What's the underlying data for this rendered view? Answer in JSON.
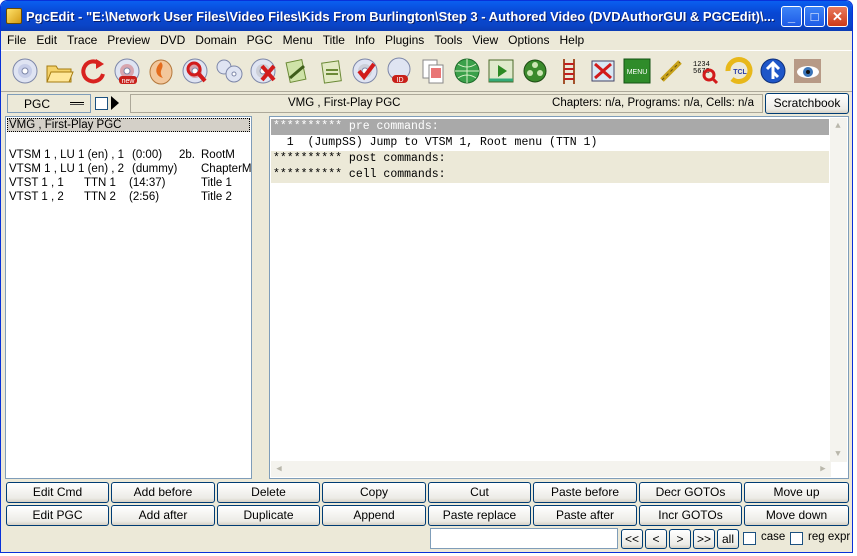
{
  "window": {
    "title": "PgcEdit -   \"E:\\Network User Files\\Video Files\\Kids From Burlington\\Step 3 - Authored Video (DVDAuthorGUI & PGCEdit)\\...",
    "minimize": "_",
    "maximize": "□",
    "close": "✕"
  },
  "menu": [
    "File",
    "Edit",
    "Trace",
    "Preview",
    "DVD",
    "Domain",
    "PGC",
    "Menu",
    "Title",
    "Info",
    "Plugins",
    "Tools",
    "View",
    "Options",
    "Help"
  ],
  "toolbar_icons": [
    "open-dvd-icon",
    "open-folder-icon",
    "reload-icon",
    "new-dvd-icon",
    "burn-icon",
    "search-dvd-icon",
    "dvd-structure-icon",
    "dvd-delete-icon",
    "copy-commands-icon",
    "paste-commands-icon",
    "check-icon",
    "dvd-id-icon",
    "documents-icon",
    "web-icon",
    "play-preview-icon",
    "film-reel-icon",
    "ladder-icon",
    "cell-editor-icon",
    "menu-icon",
    "chain-link-icon",
    "gprm-search-icon",
    "tcl-icon",
    "navigate-icon",
    "eye-icon"
  ],
  "toolbar_labels": {
    "menu_icon_text": "MENU",
    "tcl_text": "TCL",
    "id_text": "ID",
    "new_text": "new"
  },
  "pgc_selector": {
    "value": "PGC"
  },
  "status": {
    "pgc_name": "VMG , First-Play PGC",
    "counts": "Chapters: n/a, Programs: n/a, Cells: n/a",
    "scratchbook": "Scratchbook"
  },
  "pgc_list": {
    "header": "VMG , First-Play PGC",
    "rows": [
      {
        "domain": "VTSM 1 , LU 1 (en) , 1",
        "time": "(0:00)",
        "extra": "2b.",
        "menu": "RootM"
      },
      {
        "domain": "VTSM 1 , LU 1 (en) , 2",
        "time": "(dummy)",
        "extra": "",
        "menu": "ChapterM"
      },
      {
        "domain": "VTST 1 , 1",
        "time": "TTN 1",
        "extra": "(14:37)",
        "menu": "Title 1"
      },
      {
        "domain": "VTST 1 , 2",
        "time": "TTN 2",
        "extra": "(2:56)",
        "menu": "Title 2"
      }
    ]
  },
  "commands": [
    "********** pre commands:",
    "  1  (JumpSS) Jump to VTSM 1, Root menu (TTN 1)",
    "********** post commands:",
    "********** cell commands:"
  ],
  "buttons": {
    "row1": [
      "Edit Cmd",
      "Add before",
      "Delete",
      "Copy",
      "Cut",
      "Paste before",
      "Decr GOTOs",
      "Move up"
    ],
    "row2": [
      "Edit PGC",
      "Add after",
      "Duplicate",
      "Append",
      "Paste replace",
      "Paste after",
      "Incr GOTOs",
      "Move down"
    ]
  },
  "find": {
    "value": "",
    "nav": [
      "<<",
      "<",
      ">",
      ">>"
    ],
    "all": "all",
    "case_label": "case",
    "regexp_label": "reg expr"
  },
  "colors": {
    "title_bar": "#0a5ff0",
    "window_bg": "#ece9d8",
    "selected_line": "#a9a9a9"
  }
}
